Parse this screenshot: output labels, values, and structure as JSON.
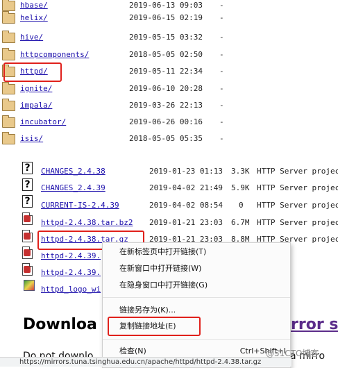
{
  "dir_listing": [
    {
      "name": "hbase/",
      "date": "2019-06-13 09:03",
      "size": "-"
    },
    {
      "name": "helix/",
      "date": "2019-06-15 02:19",
      "size": "-"
    },
    {
      "name": "hive/",
      "date": "2019-05-15 03:32",
      "size": "-"
    },
    {
      "name": "httpcomponents/",
      "date": "2018-05-05 02:50",
      "size": "-"
    },
    {
      "name": "httpd/",
      "date": "2019-05-11 22:34",
      "size": "-"
    },
    {
      "name": "ignite/",
      "date": "2019-06-10 20:28",
      "size": "-"
    },
    {
      "name": "impala/",
      "date": "2019-03-26 22:13",
      "size": "-"
    },
    {
      "name": "incubator/",
      "date": "2019-06-26 00:16",
      "size": "-"
    },
    {
      "name": "isis/",
      "date": "2018-05-05 05:35",
      "size": "-"
    }
  ],
  "file_listing": [
    {
      "name": "CHANGES_2.4.38",
      "date": "2019-01-23 01:13",
      "size": "3.3K",
      "desc": "HTTP Server projec",
      "icon": "question-icon"
    },
    {
      "name": "CHANGES_2.4.39",
      "date": "2019-04-02 21:49",
      "size": "5.9K",
      "desc": "HTTP Server projec",
      "icon": "question-icon"
    },
    {
      "name": "CURRENT-IS-2.4.39",
      "date": "2019-04-02 08:54",
      "size": "0",
      "desc": "HTTP Server projec",
      "icon": "question-icon"
    },
    {
      "name": "httpd-2.4.38.tar.bz2",
      "date": "2019-01-21 23:03",
      "size": "6.7M",
      "desc": "HTTP Server projec",
      "icon": "archive-icon"
    },
    {
      "name": "httpd-2.4.38.tar.gz",
      "date": "2019-01-21 23:03",
      "size": "8.8M",
      "desc": "HTTP Server projec",
      "icon": "archive-icon"
    },
    {
      "name": "httpd-2.4.39.",
      "icon": "archive-icon"
    },
    {
      "name": "httpd-2.4.39.",
      "icon": "archive-icon"
    },
    {
      "name": "httpd_logo_wi",
      "icon": "image-icon"
    }
  ],
  "context_menu": {
    "items": [
      {
        "label": "在新标签页中打开链接(T)"
      },
      {
        "label": "在新窗口中打开链接(W)"
      },
      {
        "label": "在隐身窗口中打开链接(G)"
      },
      {
        "label": "链接另存为(K)..."
      },
      {
        "label": "复制链接地址(E)"
      },
      {
        "label": "检查(N)",
        "shortcut": "Ctrl+Shift+I"
      }
    ]
  },
  "page": {
    "download_heading_left": "Downloa",
    "download_heading_right": "rror si",
    "paragraph_left": "Do not downlo",
    "paragraph_right": "a mirro",
    "watermark": "@51CTO博客"
  },
  "status_bar": {
    "url": "https://mirrors.tuna.tsinghua.edu.cn/apache/httpd/httpd-2.4.38.tar.gz"
  },
  "colors": {
    "link": "#1a0dab",
    "highlight": "#e0201b",
    "visited_heading": "#5b2c8a"
  }
}
